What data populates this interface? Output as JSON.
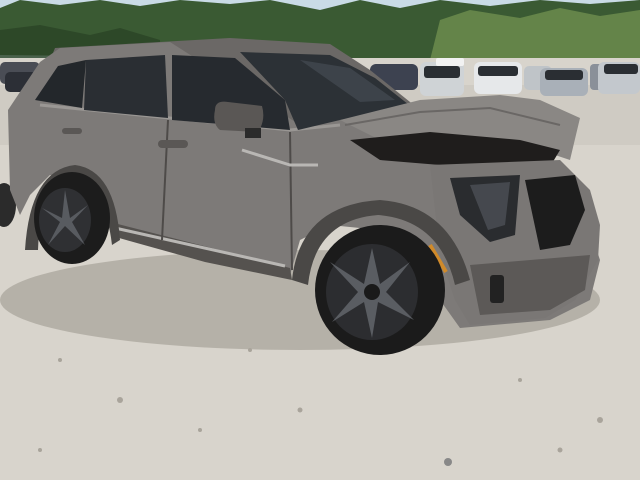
{
  "scene": {
    "subject": "damaged-suv",
    "colors": {
      "sky": "#c9dbe6",
      "trees_dark": "#2f4a2a",
      "trees_light": "#6f8f4f",
      "gravel": "#d8d4cc",
      "gravel_shadow": "#b8b3aa",
      "body": "#7d7a78",
      "body_dark": "#5e5b59",
      "body_light": "#9a9794",
      "glass": "#23272b",
      "tire": "#1c1c1c",
      "rim": "#2a2a2a",
      "trim": "#b9b7b4"
    }
  }
}
